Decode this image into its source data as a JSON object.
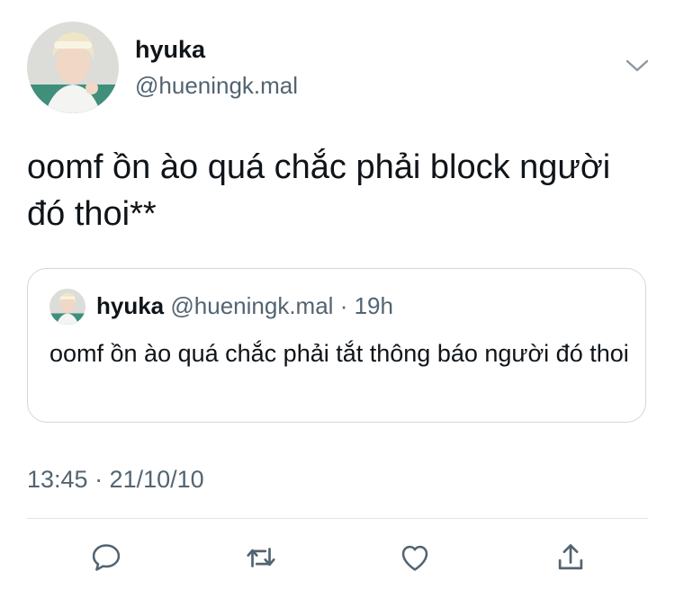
{
  "tweet": {
    "display_name": "hyuka",
    "handle": "@hueningk.mal",
    "text": "oomf ồn ào quá chắc phải block người đó thoi**",
    "timestamp": "13:45 · 21/10/10"
  },
  "quoted_tweet": {
    "display_name": "hyuka",
    "handle": "@hueningk.mal",
    "separator": "·",
    "time": "19h",
    "text": "oomf ồn ào quá chắc phải tắt thông báo người đó thoi"
  },
  "icons": {
    "menu": "chevron-down-icon",
    "reply": "reply-icon",
    "retweet": "retweet-icon",
    "like": "heart-icon",
    "share": "share-icon"
  },
  "colors": {
    "text_primary": "#0f1419",
    "text_secondary": "#536471",
    "icon": "#536471",
    "border": "#cfd9de"
  }
}
